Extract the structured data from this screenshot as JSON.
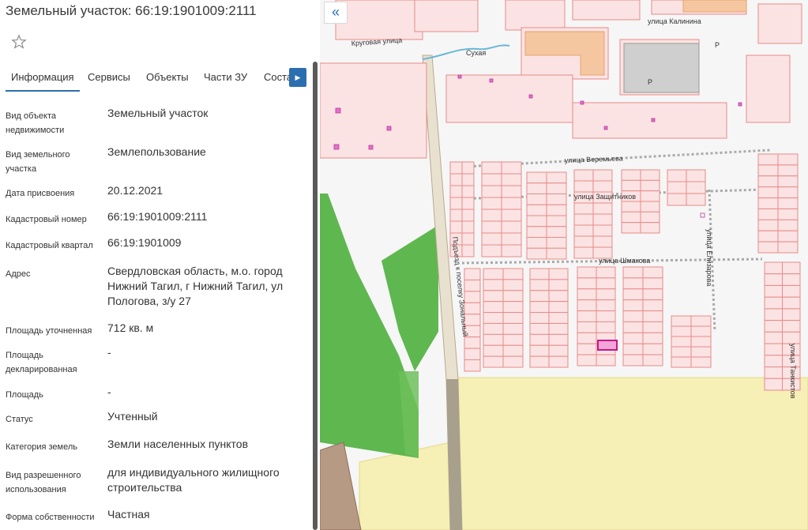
{
  "header": {
    "title": "Земельный участок: 66:19:1901009:2111"
  },
  "tabs": [
    {
      "label": "Информация"
    },
    {
      "label": "Сервисы"
    },
    {
      "label": "Объекты"
    },
    {
      "label": "Части ЗУ"
    },
    {
      "label": "Соста"
    }
  ],
  "info": [
    {
      "label": "Вид объекта недвижимости",
      "value": "Земельный участок"
    },
    {
      "label": "Вид земельного участка",
      "value": "Землепользование"
    },
    {
      "label": "Дата присвоения",
      "value": "20.12.2021"
    },
    {
      "label": "Кадастровый номер",
      "value": "66:19:1901009:2111"
    },
    {
      "label": "Кадастровый квартал",
      "value": "66:19:1901009"
    },
    {
      "label": "Адрес",
      "value": "Свердловская область, м.о. город Нижний Тагил, г Нижний Тагил, ул Пологова, з/у 27"
    },
    {
      "label": "Площадь уточненная",
      "value": "712 кв. м"
    },
    {
      "label": "Площадь декларированная",
      "value": "-"
    },
    {
      "label": "Площадь",
      "value": "-"
    },
    {
      "label": "Статус",
      "value": "Учтенный"
    },
    {
      "label": "Категория земель",
      "value": "Земли населенных пунктов"
    },
    {
      "label": "Вид разрешенного использования",
      "value": "для индивидуального жилищного строительства"
    },
    {
      "label": "Форма собственности",
      "value": "Частная"
    }
  ],
  "map": {
    "collapse_icon": "«",
    "streets": {
      "krugovaya": "Круговая улица",
      "kalinina": "улица Калинина",
      "veremeva": "улица Веремьева",
      "zashchitnikov": "улица Защитников",
      "shmakova": "улица Шмакова",
      "elizarova": "улица Елизарова",
      "tankistov": "улица Танкистов",
      "podezd": "Подъезд к поселку Зональный"
    },
    "parking_label": "P",
    "river_label": "Сухая"
  },
  "colors": {
    "accent": "#2b6fb0",
    "parcel_stroke": "#e88a8a",
    "parcel_fill": "#fbe3e3",
    "green": "#4caf3c",
    "sand": "#f7efb8",
    "selected": "#c2188b"
  }
}
